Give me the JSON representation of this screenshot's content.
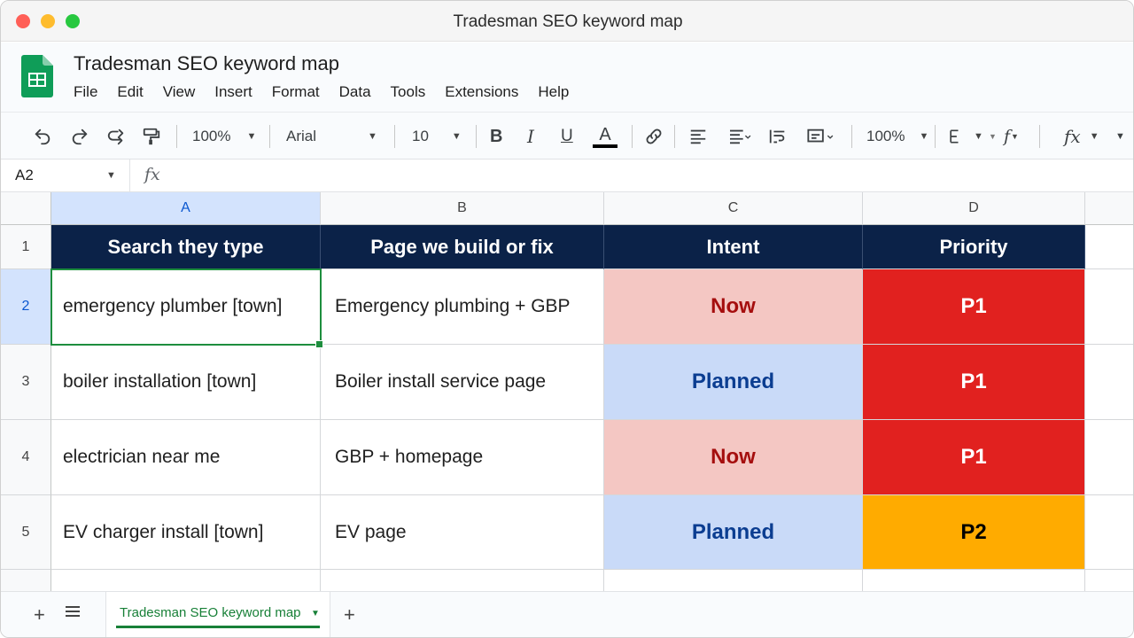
{
  "window": {
    "title": "Tradesman SEO keyword map"
  },
  "app": {
    "doc_title": "Tradesman SEO keyword map",
    "menu": [
      "File",
      "Edit",
      "View",
      "Insert",
      "Format",
      "Data",
      "Tools",
      "Extensions",
      "Help"
    ]
  },
  "toolbar": {
    "zoom": "100%",
    "font": "Arial",
    "font_size": "10",
    "zoom2": "100%",
    "icons": [
      "undo-icon",
      "redo-icon",
      "redo-icon",
      "paint-format-icon",
      "bold-icon",
      "italic-icon",
      "underline-icon",
      "text-color-icon",
      "link-icon",
      "align-left-icon",
      "align-icon",
      "wrap-icon",
      "valign-icon",
      "borders-icon",
      "function-icon"
    ]
  },
  "formula_bar": {
    "cell_ref": "A2",
    "fx": "fx",
    "value": ""
  },
  "grid": {
    "columns": [
      "A",
      "B",
      "C",
      "D"
    ],
    "rows": [
      "1",
      "2",
      "3",
      "4",
      "5"
    ],
    "header": [
      "Search they type",
      "Page we build or fix",
      "Intent",
      "Priority"
    ],
    "data": [
      {
        "search": "emergency plumber [town]",
        "page": "Emergency plumbing + GBP",
        "intent": "Now",
        "priority": "P1"
      },
      {
        "search": "boiler installation [town]",
        "page": "Boiler install service page",
        "intent": "Planned",
        "priority": "P1"
      },
      {
        "search": "electrician near me",
        "page": "GBP + homepage",
        "intent": "Now",
        "priority": "P1"
      },
      {
        "search": "EV charger install [town]",
        "page": "EV page",
        "intent": "Planned",
        "priority": "P2"
      }
    ],
    "selected_cell": "A2"
  },
  "colors": {
    "header_bg": "#0b2248",
    "now_bg": "#f4c7c3",
    "now_text": "#a50e0e",
    "planned_bg": "#c9daf8",
    "planned_text": "#0b3d91",
    "p1_bg": "#e1211f",
    "p1_text": "#ffffff",
    "p2_bg": "#ffab00",
    "p2_text": "#000000",
    "accent": "#188038"
  },
  "sheets": {
    "active": "Tradesman SEO keyword map"
  }
}
